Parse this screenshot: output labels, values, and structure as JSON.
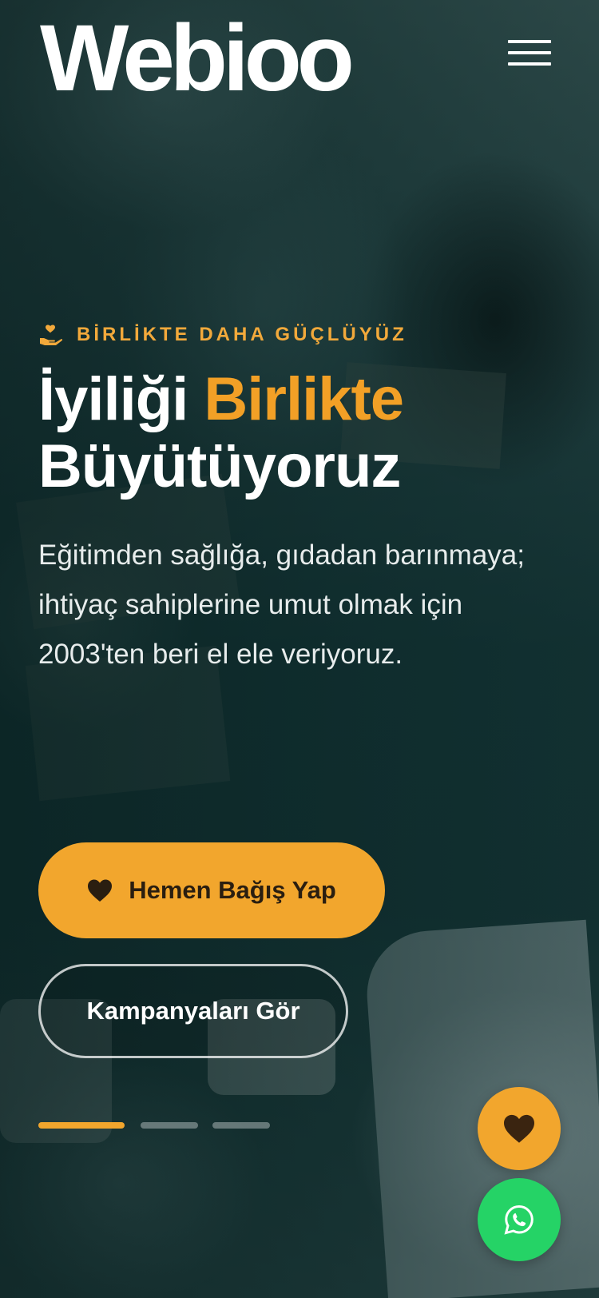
{
  "header": {
    "logo_text": "Webioo",
    "menu_icon": "hamburger-menu-icon"
  },
  "hero": {
    "background_image": "volunteers-with-donation-boxes-photo",
    "eyebrow_icon": "hand-heart-icon",
    "eyebrow": "BİRLİKTE DAHA GÜÇLÜYÜZ",
    "title_part1": "İyiliği ",
    "title_accent": "Birlikte",
    "title_part2": "Büyütüyoruz",
    "description": "Eğitimden sağlığa, gıdadan barınmaya; ihtiyaç sahiplerine umut olmak için 2003'ten beri el ele veriyoruz.",
    "primary_button": {
      "icon": "heart-icon",
      "label": "Hemen Bağış Yap"
    },
    "secondary_button": {
      "label": "Kampanyaları Gör"
    },
    "slider": {
      "slides": 3,
      "active_index": 0
    }
  },
  "floating": {
    "donate_icon": "heart-icon",
    "whatsapp_icon": "whatsapp-icon"
  },
  "colors": {
    "accent": "#f2a62d",
    "accent_text": "#f2a026",
    "whatsapp": "#25d366",
    "overlay": "#0f2a2b"
  }
}
